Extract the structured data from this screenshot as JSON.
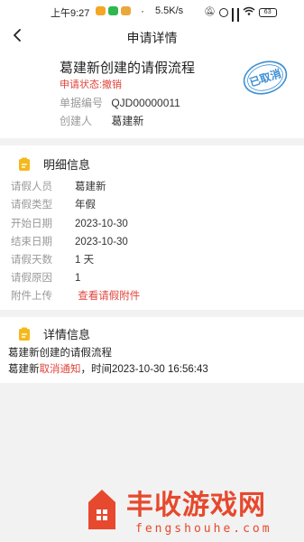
{
  "status_bar": {
    "time": "上午9:27",
    "network_speed": "5.5K/s",
    "battery": "63"
  },
  "nav": {
    "title": "申请详情",
    "back_icon": "chevron-left-icon"
  },
  "header": {
    "form_title": "葛建新创建的请假流程",
    "status_text": "申请状态:撤销",
    "stamp_text": "已取消",
    "doc_no_label": "单据编号",
    "doc_no": "QJD00000011",
    "creator_label": "创建人",
    "creator": "葛建新"
  },
  "detail_section": {
    "title": "明细信息",
    "icon": "document-icon",
    "rows": [
      {
        "label": "请假人员",
        "value": "葛建新"
      },
      {
        "label": "请假类型",
        "value": "年假"
      },
      {
        "label": "开始日期",
        "value": "2023-10-30"
      },
      {
        "label": "结束日期",
        "value": "2023-10-30"
      },
      {
        "label": "请假天数",
        "value": "1 天"
      },
      {
        "label": "请假原因",
        "value": "1"
      }
    ],
    "attachment_label": "附件上传",
    "attachment_link": "查看请假附件"
  },
  "info_section": {
    "title": "详情信息",
    "icon": "clipboard-icon",
    "line1": "葛建新创建的请假流程",
    "line2_prefix": "葛建新",
    "line2_action": "取消通知",
    "line2_suffix": "，时间2023-10-30 16:56:43"
  },
  "watermark": {
    "brand": "丰收游戏网",
    "domain": "fengshouhe.com"
  },
  "colors": {
    "accent_red": "#e0453c",
    "stamp_blue": "#3d8fd4",
    "icon_yellow": "#f5b81c",
    "watermark_red": "#e6492d"
  }
}
